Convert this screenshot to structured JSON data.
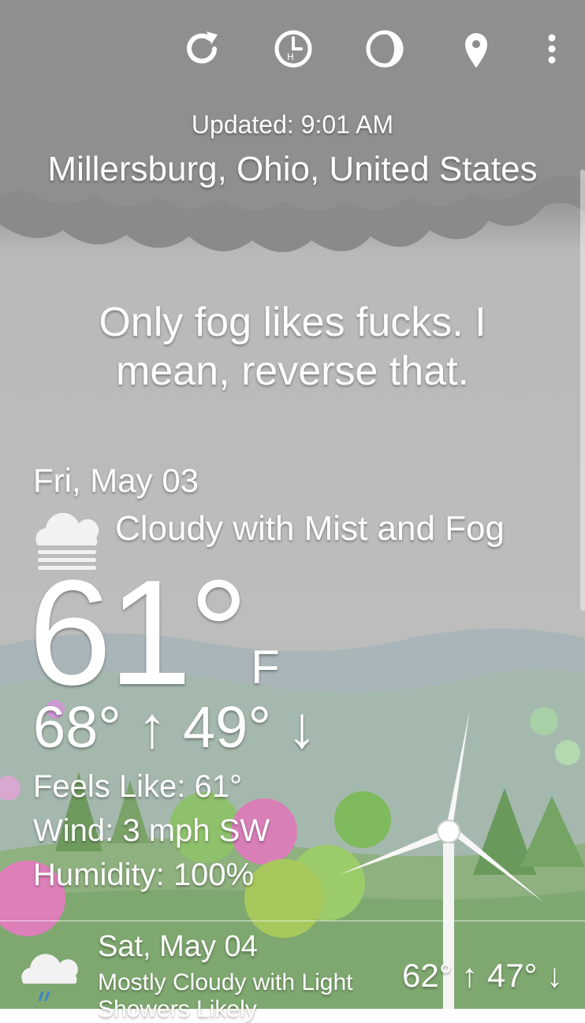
{
  "toolbar": {
    "icons": [
      "refresh-icon",
      "history-icon",
      "moon-phase-icon",
      "location-pin-icon",
      "overflow-menu-icon"
    ]
  },
  "header": {
    "updated": "Updated: 9:01 AM",
    "location": "Millersburg, Ohio, United States"
  },
  "quip": "Only fog likes fucks. I mean, reverse that.",
  "current": {
    "date": "Fri, May 03",
    "condition": "Cloudy with Mist and Fog",
    "condition_icon": "cloud-fog-icon",
    "temperature": "61°",
    "unit": "F",
    "high_low": "68° ↑ 49° ↓",
    "feels_like": "Feels Like: 61°",
    "wind": "Wind: 3 mph SW",
    "humidity": "Humidity: 100%"
  },
  "forecast": [
    {
      "date": "Sat, May 04",
      "condition": "Mostly Cloudy with Light Showers Likely",
      "icon": "cloud-rain-icon",
      "high_low": "62° ↑ 47° ↓"
    }
  ]
}
